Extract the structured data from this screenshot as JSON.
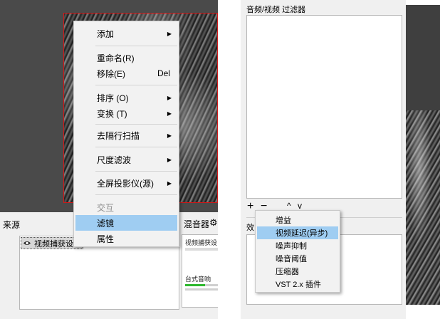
{
  "context_menu": {
    "items": [
      {
        "label": "添加",
        "submenu": true
      },
      {
        "label": "重命名(R)"
      },
      {
        "label": "移除(E)",
        "shortcut": "Del"
      },
      {
        "label": "排序 (O)",
        "submenu": true
      },
      {
        "label": "变换 (T)",
        "submenu": true
      },
      {
        "label": "去隔行扫描",
        "submenu": true
      },
      {
        "label": "尺度滤波",
        "submenu": true
      },
      {
        "label": "全屏投影仪(源)",
        "submenu": true
      },
      {
        "label": "交互",
        "disabled": true
      },
      {
        "label": "滤镜",
        "highlighted": true
      },
      {
        "label": "属性"
      }
    ]
  },
  "sources": {
    "title": "来源",
    "items": [
      {
        "name": "视频捕获设",
        "icon": "eye-icon"
      }
    ]
  },
  "mixer": {
    "title": "混音器",
    "channels": [
      {
        "name": "视频捕获设"
      },
      {
        "name": "台式音响"
      }
    ]
  },
  "filters": {
    "title": "音频/视频 过滤器",
    "effects_title": "效",
    "add_symbol": "+",
    "remove_symbol": "−",
    "up_symbol": "^",
    "down_symbol": "v"
  },
  "add_menu": {
    "items": [
      {
        "label": "增益"
      },
      {
        "label": "视频延迟(异步)",
        "highlighted": true
      },
      {
        "label": "噪声抑制"
      },
      {
        "label": "噪音阈值"
      },
      {
        "label": "压缩器"
      },
      {
        "label": "VST 2.x 插件"
      }
    ]
  },
  "colors": {
    "highlight": "#9fcdf2",
    "preview_border": "#d01818",
    "meter_green": "#2eb82e"
  }
}
